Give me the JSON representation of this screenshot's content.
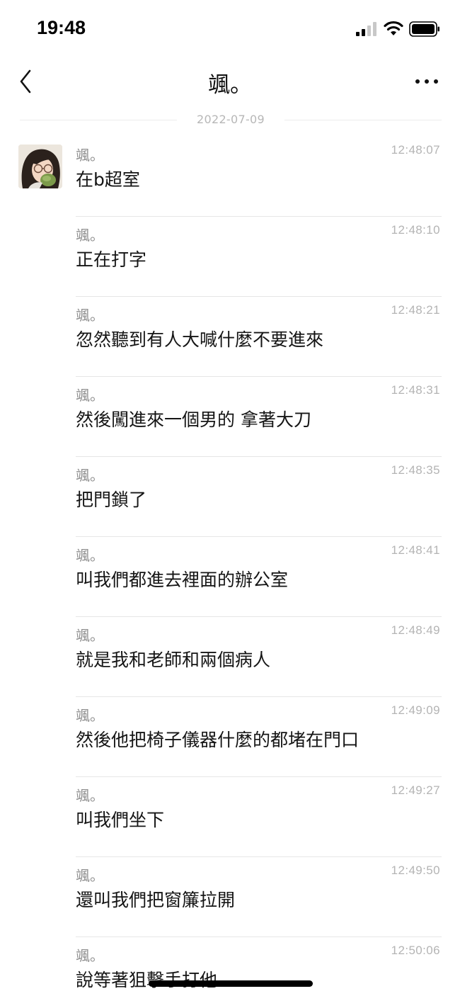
{
  "status_bar": {
    "time": "19:48",
    "signal_icon": "cellular-signal-icon",
    "wifi_icon": "wifi-icon",
    "battery_icon": "battery-icon"
  },
  "header": {
    "title": "颯。",
    "back_icon": "chevron-left-icon",
    "more_icon": "ellipsis-icon"
  },
  "date_divider": "2022-07-09",
  "messages": [
    {
      "sender": "颯。",
      "time": "12:48:07",
      "text": "在b超室"
    },
    {
      "sender": "颯。",
      "time": "12:48:10",
      "text": "正在打字"
    },
    {
      "sender": "颯。",
      "time": "12:48:21",
      "text": "忽然聽到有人大喊什麼不要進來"
    },
    {
      "sender": "颯。",
      "time": "12:48:31",
      "text": "然後闖進來一個男的 拿著大刀"
    },
    {
      "sender": "颯。",
      "time": "12:48:35",
      "text": "把門鎖了"
    },
    {
      "sender": "颯。",
      "time": "12:48:41",
      "text": "叫我們都進去裡面的辦公室"
    },
    {
      "sender": "颯。",
      "time": "12:48:49",
      "text": "就是我和老師和兩個病人"
    },
    {
      "sender": "颯。",
      "time": "12:49:09",
      "text": "然後他把椅子儀器什麼的都堵在門口"
    },
    {
      "sender": "颯。",
      "time": "12:49:27",
      "text": "叫我們坐下"
    },
    {
      "sender": "颯。",
      "time": "12:49:50",
      "text": "還叫我們把窗簾拉開"
    },
    {
      "sender": "颯。",
      "time": "12:50:06",
      "text": "說等著狙擊手打他"
    }
  ]
}
